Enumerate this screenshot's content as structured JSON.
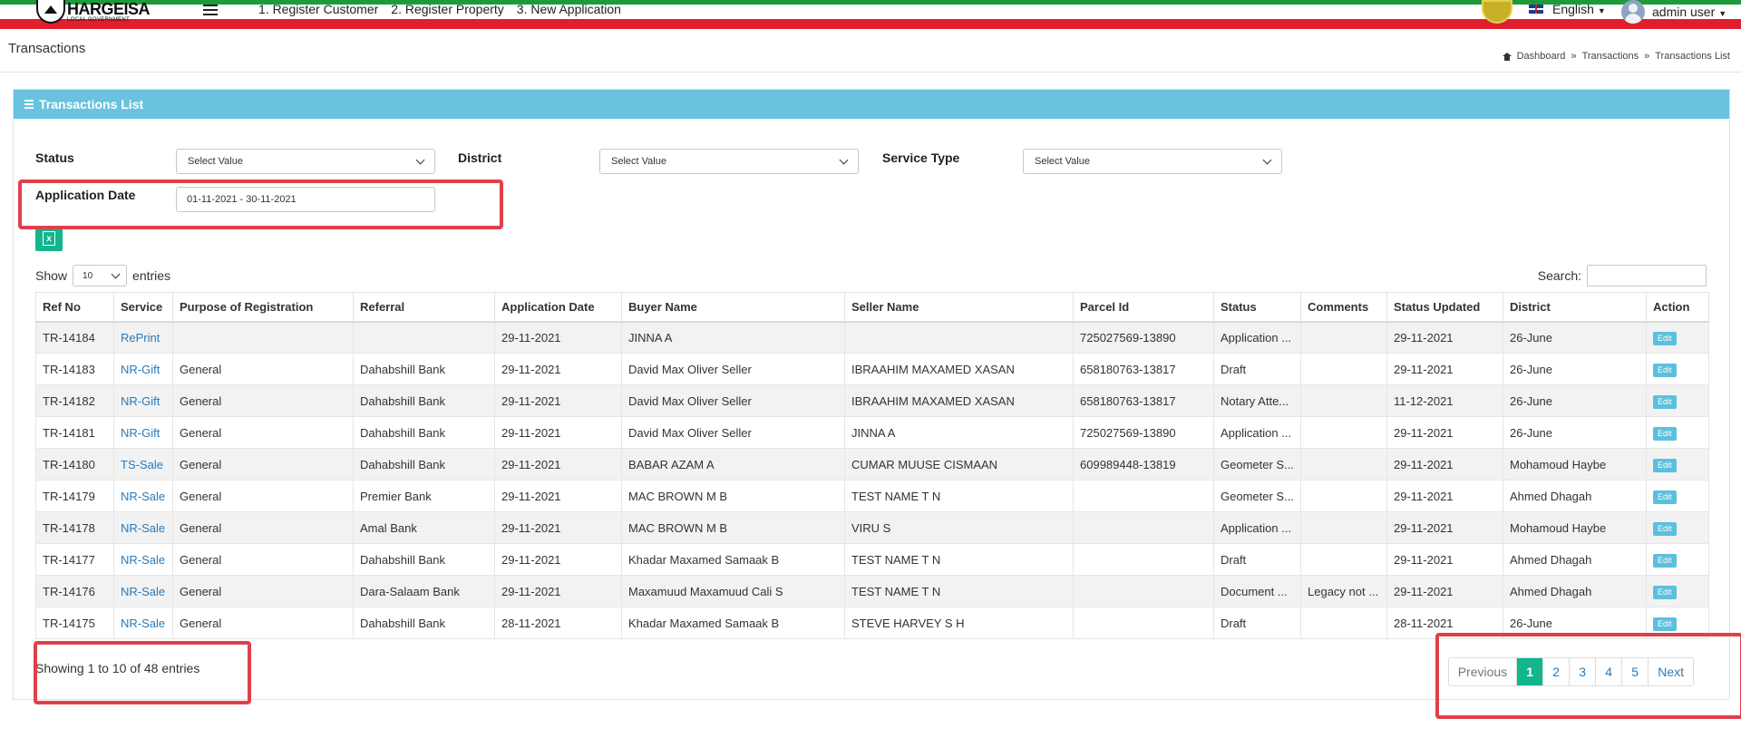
{
  "topbar": {
    "logo_line1": "HARGEISA",
    "logo_line2": "LOCAL GOVERNMENT",
    "nav": [
      "1. Register Customer",
      "2. Register Property",
      "3. New Application"
    ],
    "language": "English",
    "user": "admin user"
  },
  "page": {
    "title": "Transactions",
    "breadcrumb": [
      "Dashboard",
      "Transactions",
      "Transactions List"
    ]
  },
  "card": {
    "title": "Transactions List"
  },
  "filters": {
    "status_label": "Status",
    "status_value": "Select Value",
    "district_label": "District",
    "district_value": "Select Value",
    "service_label": "Service Type",
    "service_value": "Select Value",
    "date_label": "Application Date",
    "date_value": "01-11-2021 - 30-11-2021"
  },
  "table_controls": {
    "show": "Show",
    "length": "10",
    "entries": "entries",
    "search": "Search:"
  },
  "columns": [
    "Ref No",
    "Service",
    "Purpose of Registration",
    "Referral",
    "Application Date",
    "Buyer Name",
    "Seller Name",
    "Parcel Id",
    "Status",
    "Comments",
    "Status Updated",
    "District",
    "Action"
  ],
  "rows": [
    [
      "TR-14184",
      "RePrint",
      "",
      "",
      "29-11-2021",
      "JINNA A",
      "",
      "725027569-13890",
      "Application ...",
      "",
      "29-11-2021",
      "26-June",
      "Edit"
    ],
    [
      "TR-14183",
      "NR-Gift",
      "General",
      "Dahabshill Bank",
      "29-11-2021",
      "David Max Oliver Seller",
      "IBRAAHIM MAXAMED XASAN",
      "658180763-13817",
      "Draft",
      "",
      "29-11-2021",
      "26-June",
      "Edit"
    ],
    [
      "TR-14182",
      "NR-Gift",
      "General",
      "Dahabshill Bank",
      "29-11-2021",
      "David Max Oliver Seller",
      "IBRAAHIM MAXAMED XASAN",
      "658180763-13817",
      "Notary Atte...",
      "",
      "11-12-2021",
      "26-June",
      "Edit"
    ],
    [
      "TR-14181",
      "NR-Gift",
      "General",
      "Dahabshill Bank",
      "29-11-2021",
      "David Max Oliver Seller",
      "JINNA A",
      "725027569-13890",
      "Application ...",
      "",
      "29-11-2021",
      "26-June",
      "Edit"
    ],
    [
      "TR-14180",
      "TS-Sale",
      "General",
      "Dahabshill Bank",
      "29-11-2021",
      "BABAR AZAM A",
      "CUMAR MUUSE CISMAAN",
      "609989448-13819",
      "Geometer S...",
      "",
      "29-11-2021",
      "Mohamoud Haybe",
      "Edit"
    ],
    [
      "TR-14179",
      "NR-Sale",
      "General",
      "Premier Bank",
      "29-11-2021",
      "MAC BROWN M B",
      "TEST NAME T N",
      "",
      "Geometer S...",
      "",
      "29-11-2021",
      "Ahmed Dhagah",
      "Edit"
    ],
    [
      "TR-14178",
      "NR-Sale",
      "General",
      "Amal Bank",
      "29-11-2021",
      "MAC BROWN M B",
      "VIRU S",
      "",
      "Application ...",
      "",
      "29-11-2021",
      "Mohamoud Haybe",
      "Edit"
    ],
    [
      "TR-14177",
      "NR-Sale",
      "General",
      "Dahabshill Bank",
      "29-11-2021",
      "Khadar Maxamed Samaak B",
      "TEST NAME T N",
      "",
      "Draft",
      "",
      "29-11-2021",
      "Ahmed Dhagah",
      "Edit"
    ],
    [
      "TR-14176",
      "NR-Sale",
      "General",
      "Dara-Salaam Bank",
      "29-11-2021",
      "Maxamuud Maxamuud Cali S",
      "TEST NAME T N",
      "",
      "Document ...",
      "Legacy not ...",
      "29-11-2021",
      "Ahmed Dhagah",
      "Edit"
    ],
    [
      "TR-14175",
      "NR-Sale",
      "General",
      "Dahabshill Bank",
      "28-11-2021",
      "Khadar Maxamed Samaak B",
      "STEVE HARVEY S H",
      "",
      "Draft",
      "",
      "28-11-2021",
      "26-June",
      "Edit"
    ]
  ],
  "info": "Showing 1 to 10 of 48 entries",
  "pager": [
    "Previous",
    "1",
    "2",
    "3",
    "4",
    "5",
    "Next"
  ],
  "colors": {
    "header_bar": "#69c3e0",
    "accent_green": "#13b58c",
    "annotation": "#e0404a"
  }
}
